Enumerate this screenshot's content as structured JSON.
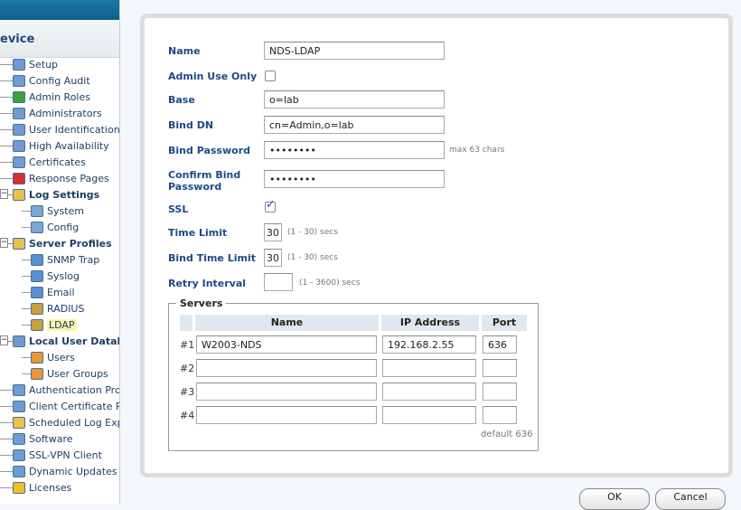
{
  "sidebar": {
    "section_title": "evice",
    "items": [
      {
        "label": "Setup",
        "icon": "setup-icon",
        "level": 0,
        "bold": false
      },
      {
        "label": "Config Audit",
        "icon": "config-audit-icon",
        "level": 0,
        "bold": false
      },
      {
        "label": "Admin Roles",
        "icon": "admin-roles-icon",
        "level": 0,
        "bold": false
      },
      {
        "label": "Administrators",
        "icon": "administrator-icon",
        "level": 0,
        "bold": false
      },
      {
        "label": "User Identification",
        "icon": "user-identification-icon",
        "level": 0,
        "bold": false
      },
      {
        "label": "High Availability",
        "icon": "high-availability-icon",
        "level": 0,
        "bold": false
      },
      {
        "label": "Certificates",
        "icon": "certificate-icon",
        "level": 0,
        "bold": false
      },
      {
        "label": "Response Pages",
        "icon": "response-pages-icon",
        "level": 0,
        "bold": false
      },
      {
        "label": "Log Settings",
        "icon": "folder-icon",
        "level": 0,
        "bold": true,
        "expanded": true
      },
      {
        "label": "System",
        "icon": "document-icon",
        "level": 1,
        "bold": false
      },
      {
        "label": "Config",
        "icon": "document-icon",
        "level": 1,
        "bold": false
      },
      {
        "label": "Server Profiles",
        "icon": "folder-icon",
        "level": 0,
        "bold": true,
        "expanded": true
      },
      {
        "label": "SNMP Trap",
        "icon": "server-icon",
        "level": 1,
        "bold": false
      },
      {
        "label": "Syslog",
        "icon": "server-icon",
        "level": 1,
        "bold": false
      },
      {
        "label": "Email",
        "icon": "server-icon",
        "level": 1,
        "bold": false
      },
      {
        "label": "RADIUS",
        "icon": "server-lock-icon",
        "level": 1,
        "bold": false
      },
      {
        "label": "LDAP",
        "icon": "server-lock-icon",
        "level": 1,
        "bold": false,
        "selected": true
      },
      {
        "label": "Local User Databa",
        "icon": "user-database-icon",
        "level": 0,
        "bold": true,
        "expanded": true
      },
      {
        "label": "Users",
        "icon": "user-icon",
        "level": 1,
        "bold": false
      },
      {
        "label": "User Groups",
        "icon": "user-group-icon",
        "level": 1,
        "bold": false
      },
      {
        "label": "Authentication Profil",
        "icon": "authentication-icon",
        "level": 0,
        "bold": false
      },
      {
        "label": "Client Certificate Pro",
        "icon": "certificate-icon",
        "level": 0,
        "bold": false
      },
      {
        "label": "Scheduled Log Export",
        "icon": "folder-icon",
        "level": 0,
        "bold": false
      },
      {
        "label": "Software",
        "icon": "software-icon",
        "level": 0,
        "bold": false
      },
      {
        "label": "SSL-VPN Client",
        "icon": "vpn-icon",
        "level": 0,
        "bold": false
      },
      {
        "label": "Dynamic Updates",
        "icon": "update-icon",
        "level": 0,
        "bold": false
      },
      {
        "label": "Licenses",
        "icon": "key-icon",
        "level": 0,
        "bold": false
      }
    ]
  },
  "form": {
    "name_label": "Name",
    "name_value": "NDS-LDAP",
    "admin_label": "Admin Use Only",
    "admin_checked": false,
    "base_label": "Base",
    "base_value": "o=lab",
    "binddn_label": "Bind DN",
    "binddn_value": "cn=Admin,o=lab",
    "bindpw_label": "Bind Password",
    "bindpw_value": "••••••••",
    "bindpw_hint": "max 63 chars",
    "confirm_label_1": "Confirm Bind",
    "confirm_label_2": "Password",
    "confirm_value": "••••••••",
    "ssl_label": "SSL",
    "ssl_checked": true,
    "time_label": "Time Limit",
    "time_value": "30",
    "time_hint": "(1 - 30) secs",
    "bindtime_label": "Bind Time Limit",
    "bindtime_value": "30",
    "bindtime_hint": "(1 - 30) secs",
    "retry_label": "Retry Interval",
    "retry_value": "",
    "retry_hint": "(1 - 3600) secs"
  },
  "servers": {
    "legend": "Servers",
    "columns": [
      "Name",
      "IP Address",
      "Port"
    ],
    "rows": [
      {
        "num": "#1",
        "name": "W2003-NDS",
        "ip": "192.168.2.55",
        "port": "636"
      },
      {
        "num": "#2",
        "name": "",
        "ip": "",
        "port": ""
      },
      {
        "num": "#3",
        "name": "",
        "ip": "",
        "port": ""
      },
      {
        "num": "#4",
        "name": "",
        "ip": "",
        "port": ""
      }
    ],
    "port_hint": "default 636"
  },
  "buttons": {
    "ok": "OK",
    "cancel": "Cancel"
  },
  "colors": {
    "label": "#1c4a8a",
    "header_band": "#0d5f86",
    "table_header": "#dfe8f1"
  }
}
